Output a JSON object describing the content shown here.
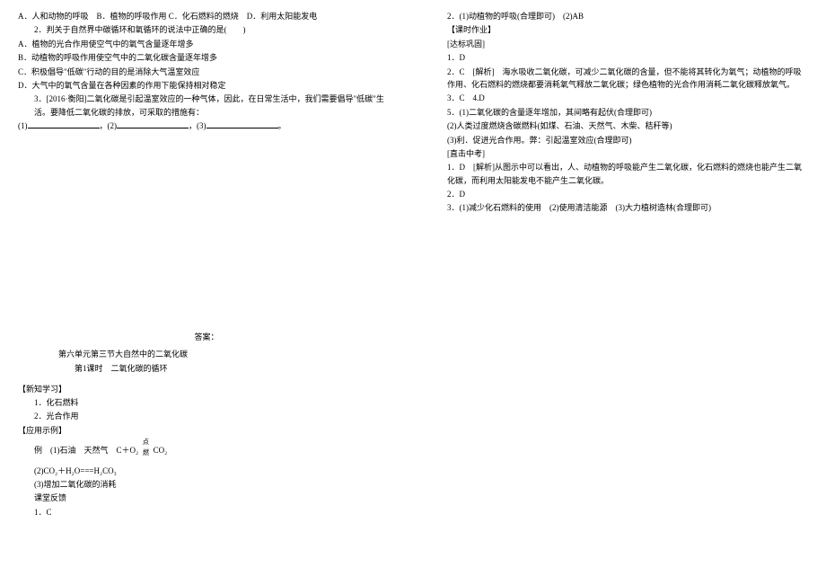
{
  "left": {
    "q1_options": "A．人和动物的呼吸　B．植物的呼吸作用 C．化石燃料的燃烧　D．利用太阳能发电",
    "q2_stem": "2．判关于自然界中碳循环和氧循环的说法中正确的是(　　)",
    "q2_A": "A．植物的光合作用使空气中的氧气含量逐年增多",
    "q2_B": "B．动植物的呼吸作用使空气中的二氧化碳含量逐年增多",
    "q2_C": "C．积极倡导\"低碳\"行动的目的是消除大气温室效应",
    "q2_D": "D．大气中的氧气含量在各种因素的作用下能保持相对稳定",
    "q3_stem": "3．[2016·衡阳]二氧化碳是引起温室效应的一种气体，因此，在日常生活中，我们需要倡导\"低碳\"生活。要降低二氧化碳的排放，可采取的措施有：",
    "q3_blanks": "(1)__________________，(2)__________________，(3)__________________。",
    "answer_heading": "答案：",
    "unit_title": "第六单元第三节大自然中的二氧化碳",
    "lesson_title": "第1课时　二氧化碳的循环",
    "section_1": "【新知学习】",
    "s1_1": "1．化石燃料",
    "s1_2": "2．光合作用",
    "section_2": "【应用示例】",
    "ex_label": "例　(1)石油　天然气　C＋O₂",
    "ex_cond": "点燃",
    "ex_rhs": " CO₂",
    "ex_2": "(2)CO₂＋H₂O===H₂CO₃",
    "ex_3": "(3)增加二氧化碳的消耗",
    "classroom": "课堂反馈",
    "cr_1": "1．C"
  },
  "right": {
    "r_top": "2．(1)动植物的呼吸(合理即可)　(2)AB",
    "hw_heading": "【课时作业】",
    "section_db": "[达标巩固]",
    "a1": "1．D",
    "a2": "2．C　[解析]　海水吸收二氧化碳，可减少二氧化碳的含量，但不能将其转化为氧气；动植物的呼吸作用、化石燃料的燃烧都要消耗氧气释放二氧化碳；绿色植物的光合作用消耗二氧化碳释放氧气。",
    "a3": "3．C　4.D",
    "a5_1": "5．(1)二氧化碳的含量逐年增加，其间略有起伏(合理即可)",
    "a5_2": "(2)人类过度燃烧含碳燃料(如煤、石油、天然气、木柴、秸秆等)",
    "a5_3": "(3)利．促进光合作用。弊：引起温室效应(合理即可)",
    "section_zk": "[直击中考]",
    "zk_1": "1．D　[解析]从图示中可以看出，人、动植物的呼吸能产生二氧化碳，化石燃料的燃烧也能产生二氧化碳，而利用太阳能发电不能产生二氧化碳。",
    "zk_2": "2．D",
    "zk_3": "3．(1)减少化石燃料的使用　(2)使用清洁能源　(3)大力植树造林(合理即可)"
  }
}
